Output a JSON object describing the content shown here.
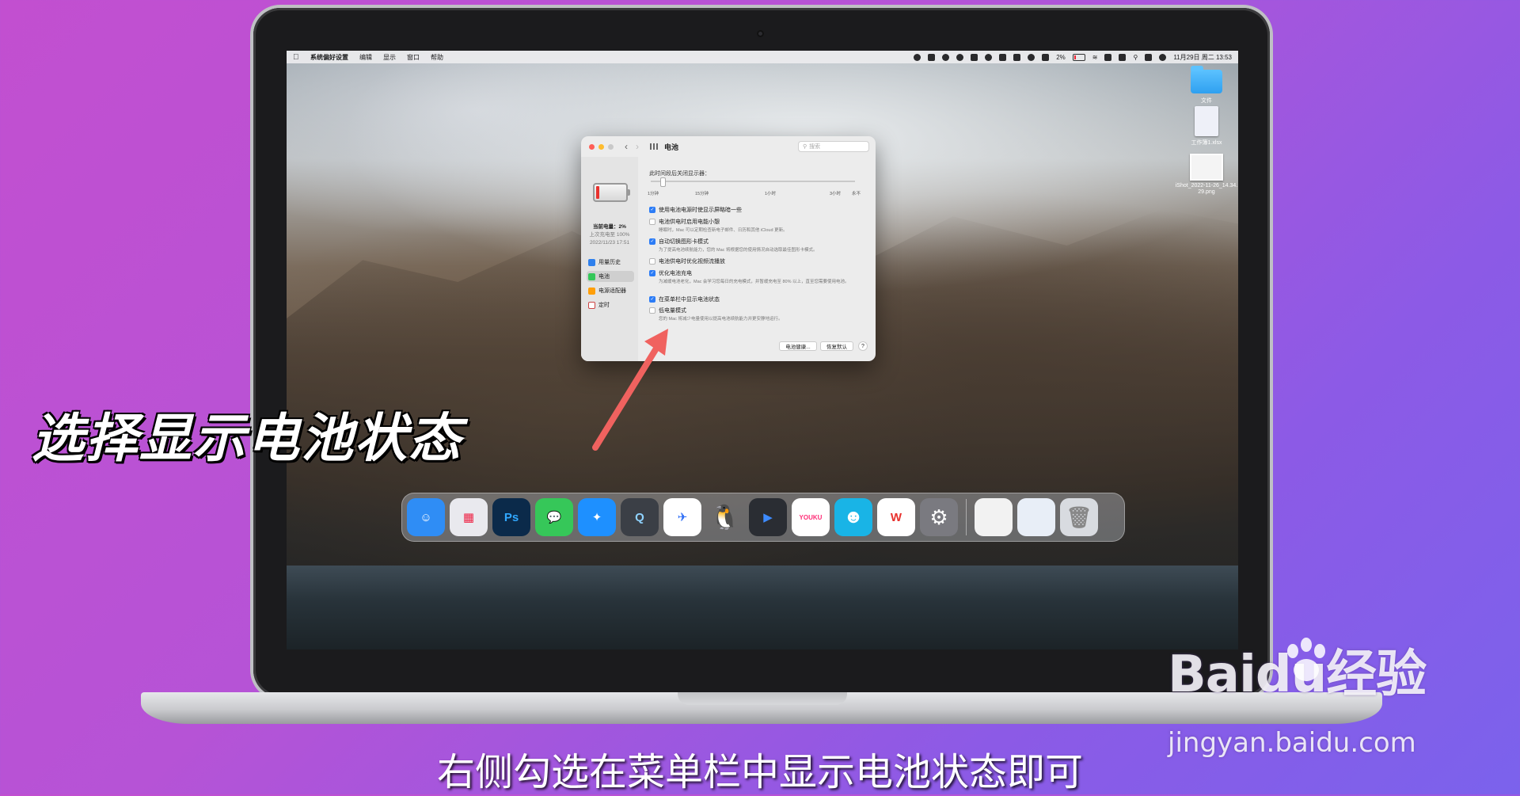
{
  "menubar": {
    "apple": "",
    "items": [
      "系统偏好设置",
      "编辑",
      "显示",
      "窗口",
      "帮助"
    ],
    "battery_percent": "2%",
    "datetime": "11月29日 周二  13:53"
  },
  "desktop": {
    "icons": [
      {
        "label": "文件",
        "kind": "folder"
      },
      {
        "label": "工作簿1.xlsx",
        "kind": "document"
      },
      {
        "label": "iShot_2022-11-26_14.34.29.png",
        "kind": "image"
      }
    ]
  },
  "window": {
    "title": "电池",
    "search_placeholder": "搜索",
    "sidebar": {
      "current_charge": "当前电量：2%",
      "last_charge": "上次充电至 100%",
      "last_charge_time": "2022/11/23 17:51",
      "items": [
        {
          "label": "用量历史",
          "color": "#2f80ed"
        },
        {
          "label": "电池",
          "color": "#34c759"
        },
        {
          "label": "电源适配器",
          "color": "#ff9f0a"
        },
        {
          "label": "定时",
          "color": "#8e8e93"
        }
      ]
    },
    "display_off_title": "此时间段后关闭显示器：",
    "slider_ticks": [
      "1分钟",
      "15分钟",
      "1小时",
      "3小时",
      "永不"
    ],
    "options": [
      {
        "label": "使用电池电源时使显示屏略暗一些",
        "checked": true,
        "desc": ""
      },
      {
        "label": "电池供电时启用电能小憩",
        "checked": false,
        "desc": "睡眠时，Mac 可以定期检查新电子邮件、日历和其他 iCloud 更新。"
      },
      {
        "label": "自动切换图形卡模式",
        "checked": true,
        "desc": "为了提高电池续航能力，您的 Mac 将根据您的使用情况自动选取最佳图形卡模式。"
      },
      {
        "label": "电池供电时优化视频流播放",
        "checked": false,
        "desc": ""
      },
      {
        "label": "优化电池充电",
        "checked": true,
        "desc": "为减缓电池老化，Mac 会学习您每日的充电模式，并暂缓充电至 80% 以上，直至您需要使用电池。"
      },
      {
        "label": "在菜单栏中显示电池状态",
        "checked": true,
        "desc": ""
      },
      {
        "label": "低电量模式",
        "checked": false,
        "desc": "您的 Mac 将减少电量使用以提高电池续航能力并更安静地运行。"
      }
    ],
    "buttons": {
      "battery_health": "电池健康...",
      "restore_defaults": "恢复默认",
      "help": "?"
    }
  },
  "dock": {
    "apps": [
      {
        "name": "finder",
        "glyph": "☺",
        "color": "#2f8df5"
      },
      {
        "name": "launchpad",
        "glyph": "▦",
        "color": "#e9e9ee"
      },
      {
        "name": "photoshop",
        "glyph": "Ps",
        "color": "#0b2a4a"
      },
      {
        "name": "messages",
        "glyph": "💬",
        "color": "#36c759"
      },
      {
        "name": "safari",
        "glyph": "✦",
        "color": "#1e90ff"
      },
      {
        "name": "quicktime",
        "glyph": "Q",
        "color": "#3b3f46"
      },
      {
        "name": "feishu",
        "glyph": "✈",
        "color": "#ffffff"
      },
      {
        "name": "qq",
        "glyph": "🐧",
        "color": "#1a1a1a"
      },
      {
        "name": "video-player",
        "glyph": "▶",
        "color": "#2a2d33"
      },
      {
        "name": "youku",
        "glyph": "YOUKU",
        "color": "#ffffff"
      },
      {
        "name": "mascot-app",
        "glyph": "☻",
        "color": "#19b4e6"
      },
      {
        "name": "wps",
        "glyph": "W",
        "color": "#ffffff"
      },
      {
        "name": "system-preferences",
        "glyph": "⚙",
        "color": "#7a7a80"
      }
    ],
    "right": [
      {
        "name": "recent-window-1",
        "color": "#f2f2f2"
      },
      {
        "name": "recent-window-2",
        "color": "#e8eef7"
      },
      {
        "name": "trash",
        "color": "#d8dbe0"
      }
    ]
  },
  "overlay": {
    "title": "选择显示电池状态",
    "subtitle": "右侧勾选在菜单栏中显示电池状态即可",
    "watermark_logo": "Baidu经验",
    "watermark_url": "jingyan.baidu.com",
    "arrow_color": "#f0625f"
  }
}
